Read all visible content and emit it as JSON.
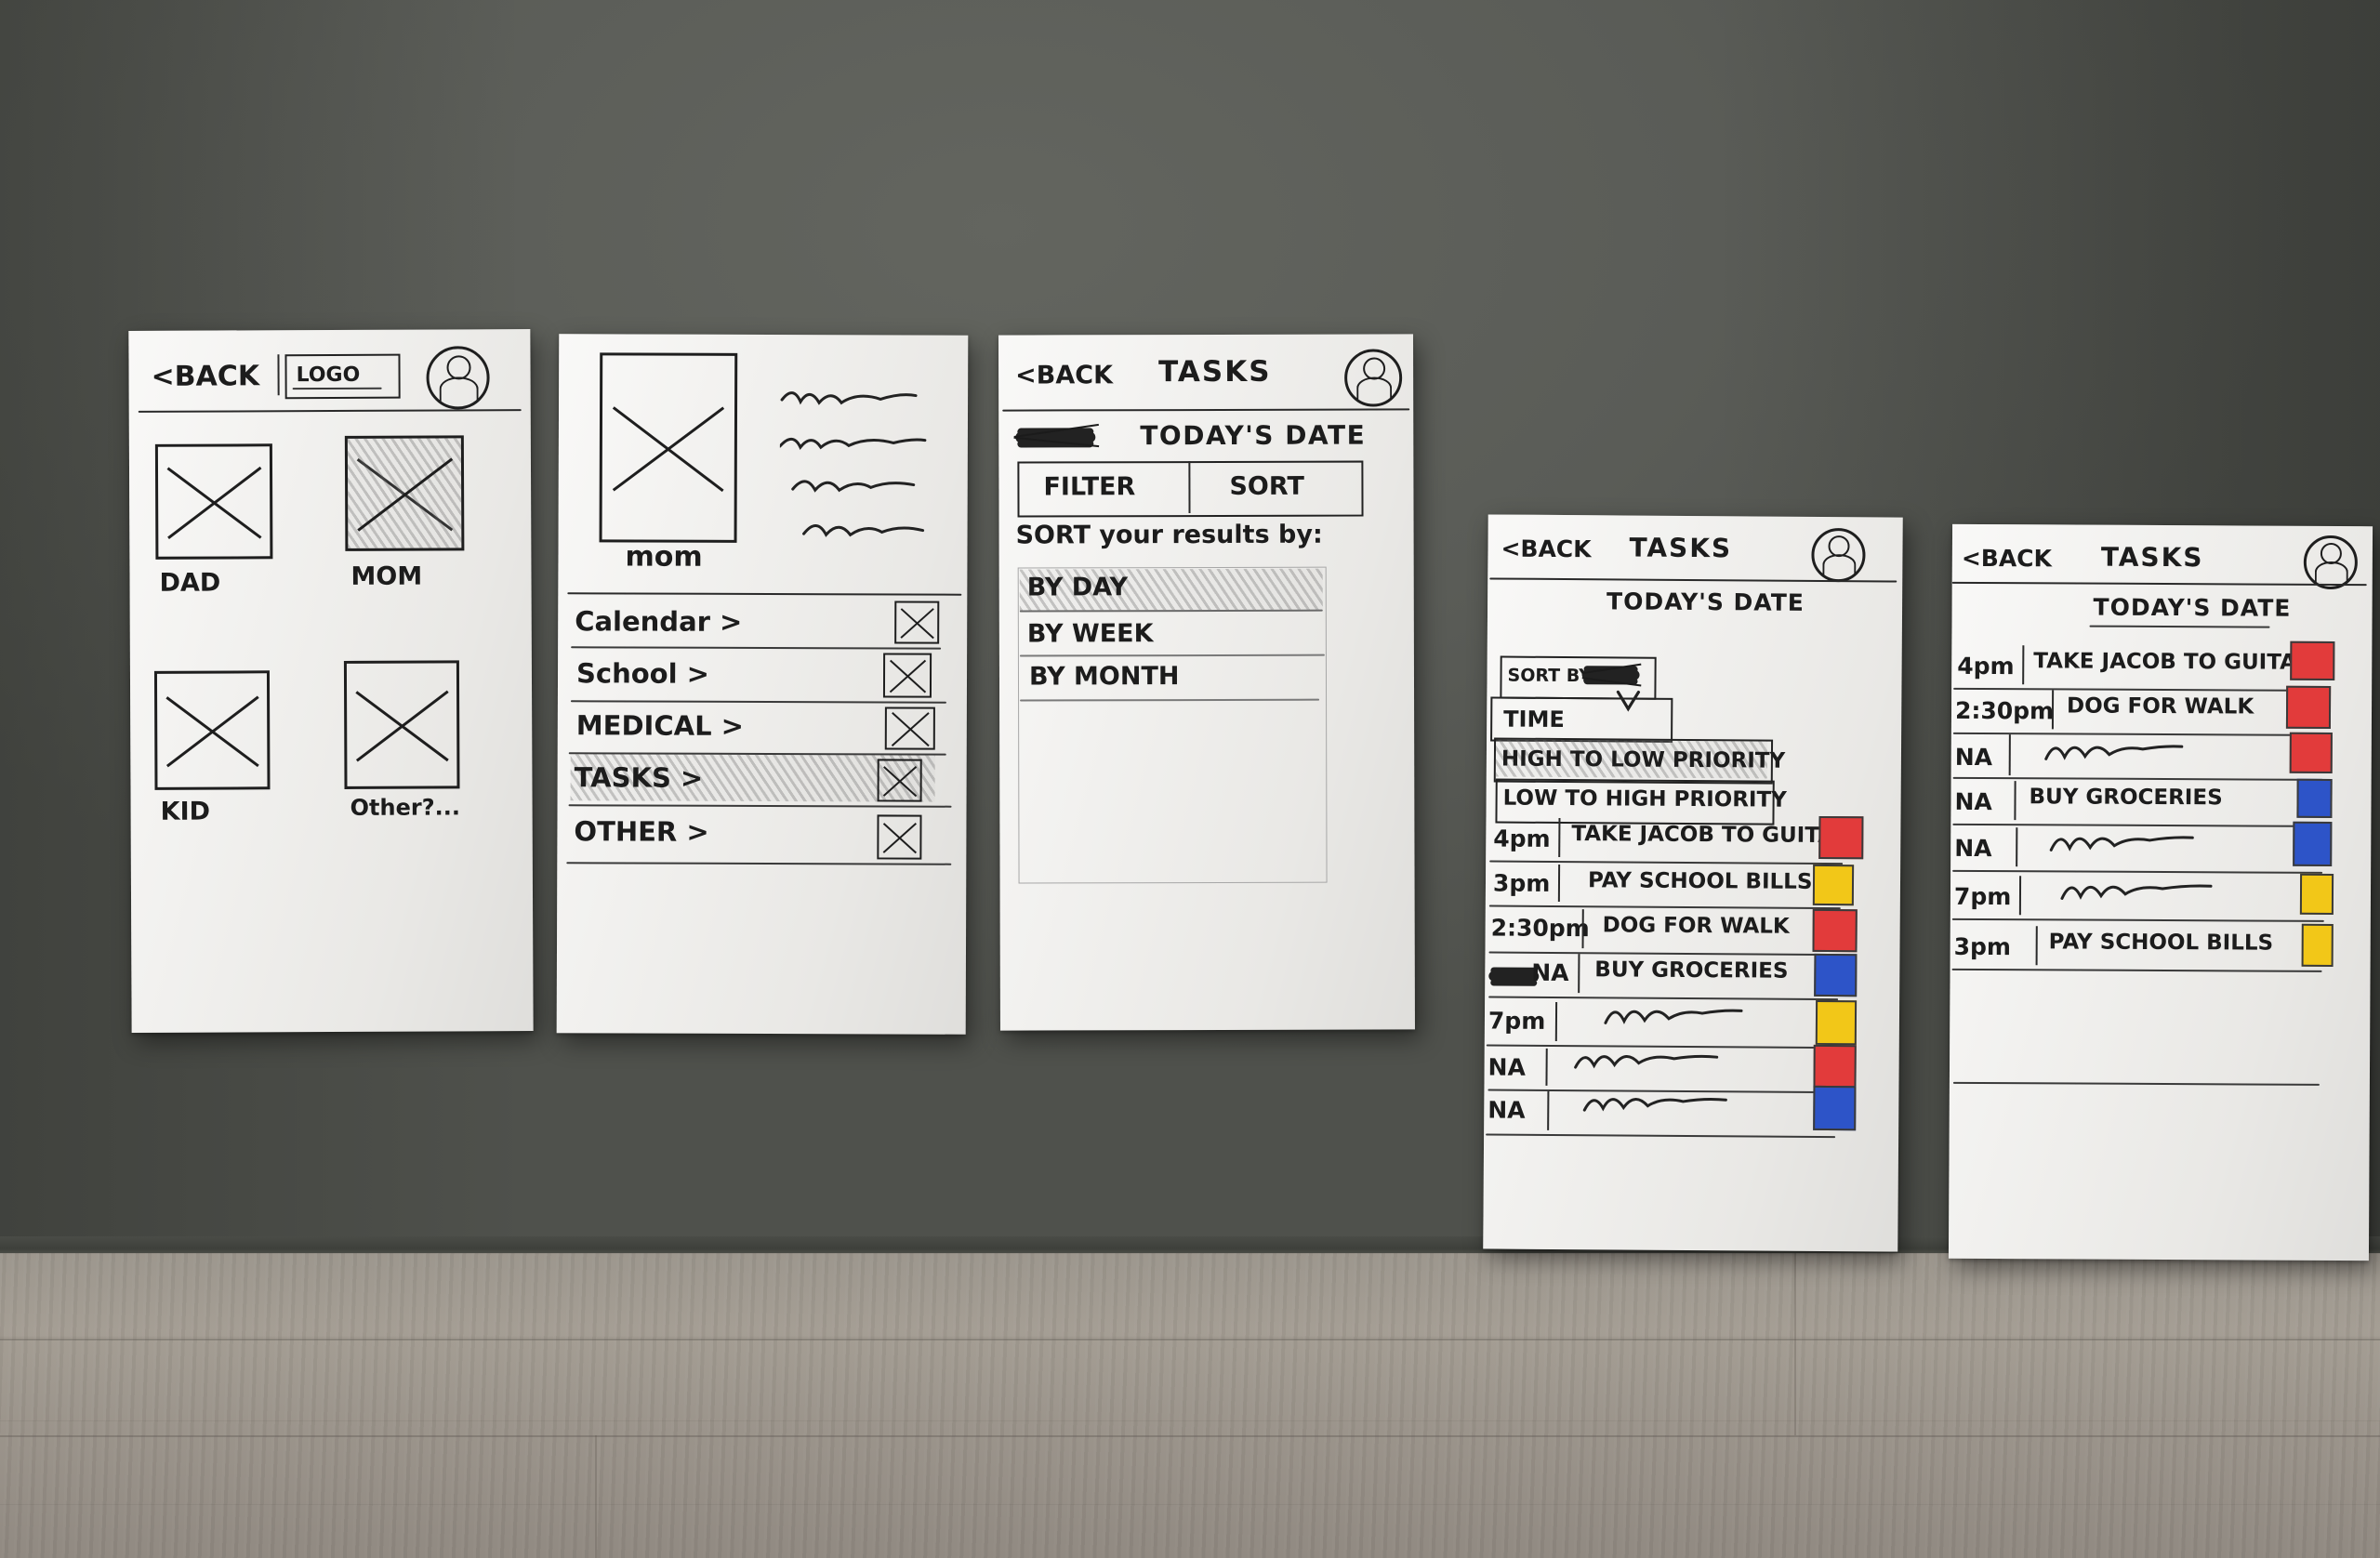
{
  "scene": {
    "description": "Five hand-drawn paper wireframe sketches taped on a dark gray wall above a light wood floor",
    "wall_color": "#5c5e59",
    "floor_color": "#9b958c",
    "paper_color": "#f2f1ee",
    "ink_color": "#1b1b1b",
    "highlight_color": "#9a9a9a",
    "priority_colors": {
      "high": "#e23b3b",
      "medium": "#f2c718",
      "low": "#2d54c8"
    }
  },
  "cards": [
    {
      "id": "card-profile-select",
      "header": {
        "back_label": "<BACK",
        "logo_label": "LOGO",
        "avatar_icon": "user-avatar-icon"
      },
      "tiles": [
        {
          "label": "DAD",
          "icon": "image-placeholder-icon",
          "selected": false
        },
        {
          "label": "MOM",
          "icon": "image-placeholder-icon",
          "selected": true
        },
        {
          "label": "KID",
          "icon": "image-placeholder-icon",
          "selected": false
        },
        {
          "label": "Other?...",
          "icon": "image-placeholder-icon",
          "selected": false
        }
      ]
    },
    {
      "id": "card-profile-menu",
      "profile": {
        "avatar_icon": "image-placeholder-icon",
        "name": "mom",
        "detail_lines": 4
      },
      "menu": [
        {
          "label": "Calendar >",
          "checkbox": "checked-box-icon",
          "selected": false
        },
        {
          "label": "School >",
          "checkbox": "checked-box-icon",
          "selected": false
        },
        {
          "label": "MEDICAL >",
          "checkbox": "checked-box-icon",
          "selected": false
        },
        {
          "label": "TASKS >",
          "checkbox": "checked-box-icon",
          "selected": true
        },
        {
          "label": "OTHER >",
          "checkbox": "checked-box-icon",
          "selected": false
        }
      ]
    },
    {
      "id": "card-tasks-sort",
      "header": {
        "back_label": "<BACK",
        "title": "TASKS",
        "avatar_icon": "user-avatar-icon"
      },
      "date_row": {
        "scribbled_word": "scribble-out-mark",
        "date_label": "TODAY'S DATE"
      },
      "tabs": [
        {
          "label": "FILTER",
          "active": false
        },
        {
          "label": "SORT",
          "active": true
        }
      ],
      "sort_prompt": "SORT your results by:",
      "sort_options": [
        {
          "label": "BY DAY",
          "selected": true
        },
        {
          "label": "BY WEEK",
          "selected": false
        },
        {
          "label": "BY MONTH",
          "selected": false
        }
      ]
    },
    {
      "id": "card-tasks-priority",
      "header": {
        "back_label": "<BACK",
        "title": "TASKS",
        "avatar_icon": "user-avatar-icon"
      },
      "date_label": "TODAY'S DATE",
      "dropdown": {
        "trigger_label": "SORT BY",
        "trigger_scribble": "scribble-out-mark",
        "caret_icon": "chevron-down-icon",
        "options": [
          {
            "label": "TIME",
            "selected": false
          },
          {
            "label": "HIGH TO LOW PRIORITY",
            "selected": true
          },
          {
            "label": "LOW TO HIGH PRIORITY",
            "selected": false
          }
        ]
      },
      "tasks": [
        {
          "time": "4pm",
          "name": "TAKE JACOB TO GUITAR",
          "squiggle": false,
          "color": "high"
        },
        {
          "time": "3pm",
          "name": "PAY SCHOOL BILLS",
          "squiggle": false,
          "color": "medium"
        },
        {
          "time": "2:30pm",
          "name": "DOG FOR WALK",
          "squiggle": false,
          "color": "high"
        },
        {
          "time": "NA",
          "name": "BUY GROCERIES",
          "squiggle": false,
          "color": "low",
          "time_scribbled": true
        },
        {
          "time": "7pm",
          "name": "",
          "squiggle": true,
          "color": "medium"
        },
        {
          "time": "NA",
          "name": "",
          "squiggle": true,
          "color": "high"
        },
        {
          "time": "NA",
          "name": "",
          "squiggle": true,
          "color": "low"
        }
      ]
    },
    {
      "id": "card-tasks-sorted",
      "header": {
        "back_label": "<BACK",
        "title": "TASKS",
        "avatar_icon": "user-avatar-icon"
      },
      "date_label": "TODAY'S DATE",
      "tasks": [
        {
          "time": "4pm",
          "name": "TAKE JACOB TO GUITAR",
          "squiggle": false,
          "color": "high"
        },
        {
          "time": "2:30pm",
          "name": "DOG FOR WALK",
          "squiggle": false,
          "color": "high"
        },
        {
          "time": "NA",
          "name": "",
          "squiggle": true,
          "color": "high"
        },
        {
          "time": "NA",
          "name": "BUY GROCERIES",
          "squiggle": false,
          "color": "low"
        },
        {
          "time": "NA",
          "name": "",
          "squiggle": true,
          "color": "low"
        },
        {
          "time": "7pm",
          "name": "",
          "squiggle": true,
          "color": "medium"
        },
        {
          "time": "3pm",
          "name": "PAY SCHOOL BILLS",
          "squiggle": false,
          "color": "medium"
        }
      ]
    }
  ]
}
